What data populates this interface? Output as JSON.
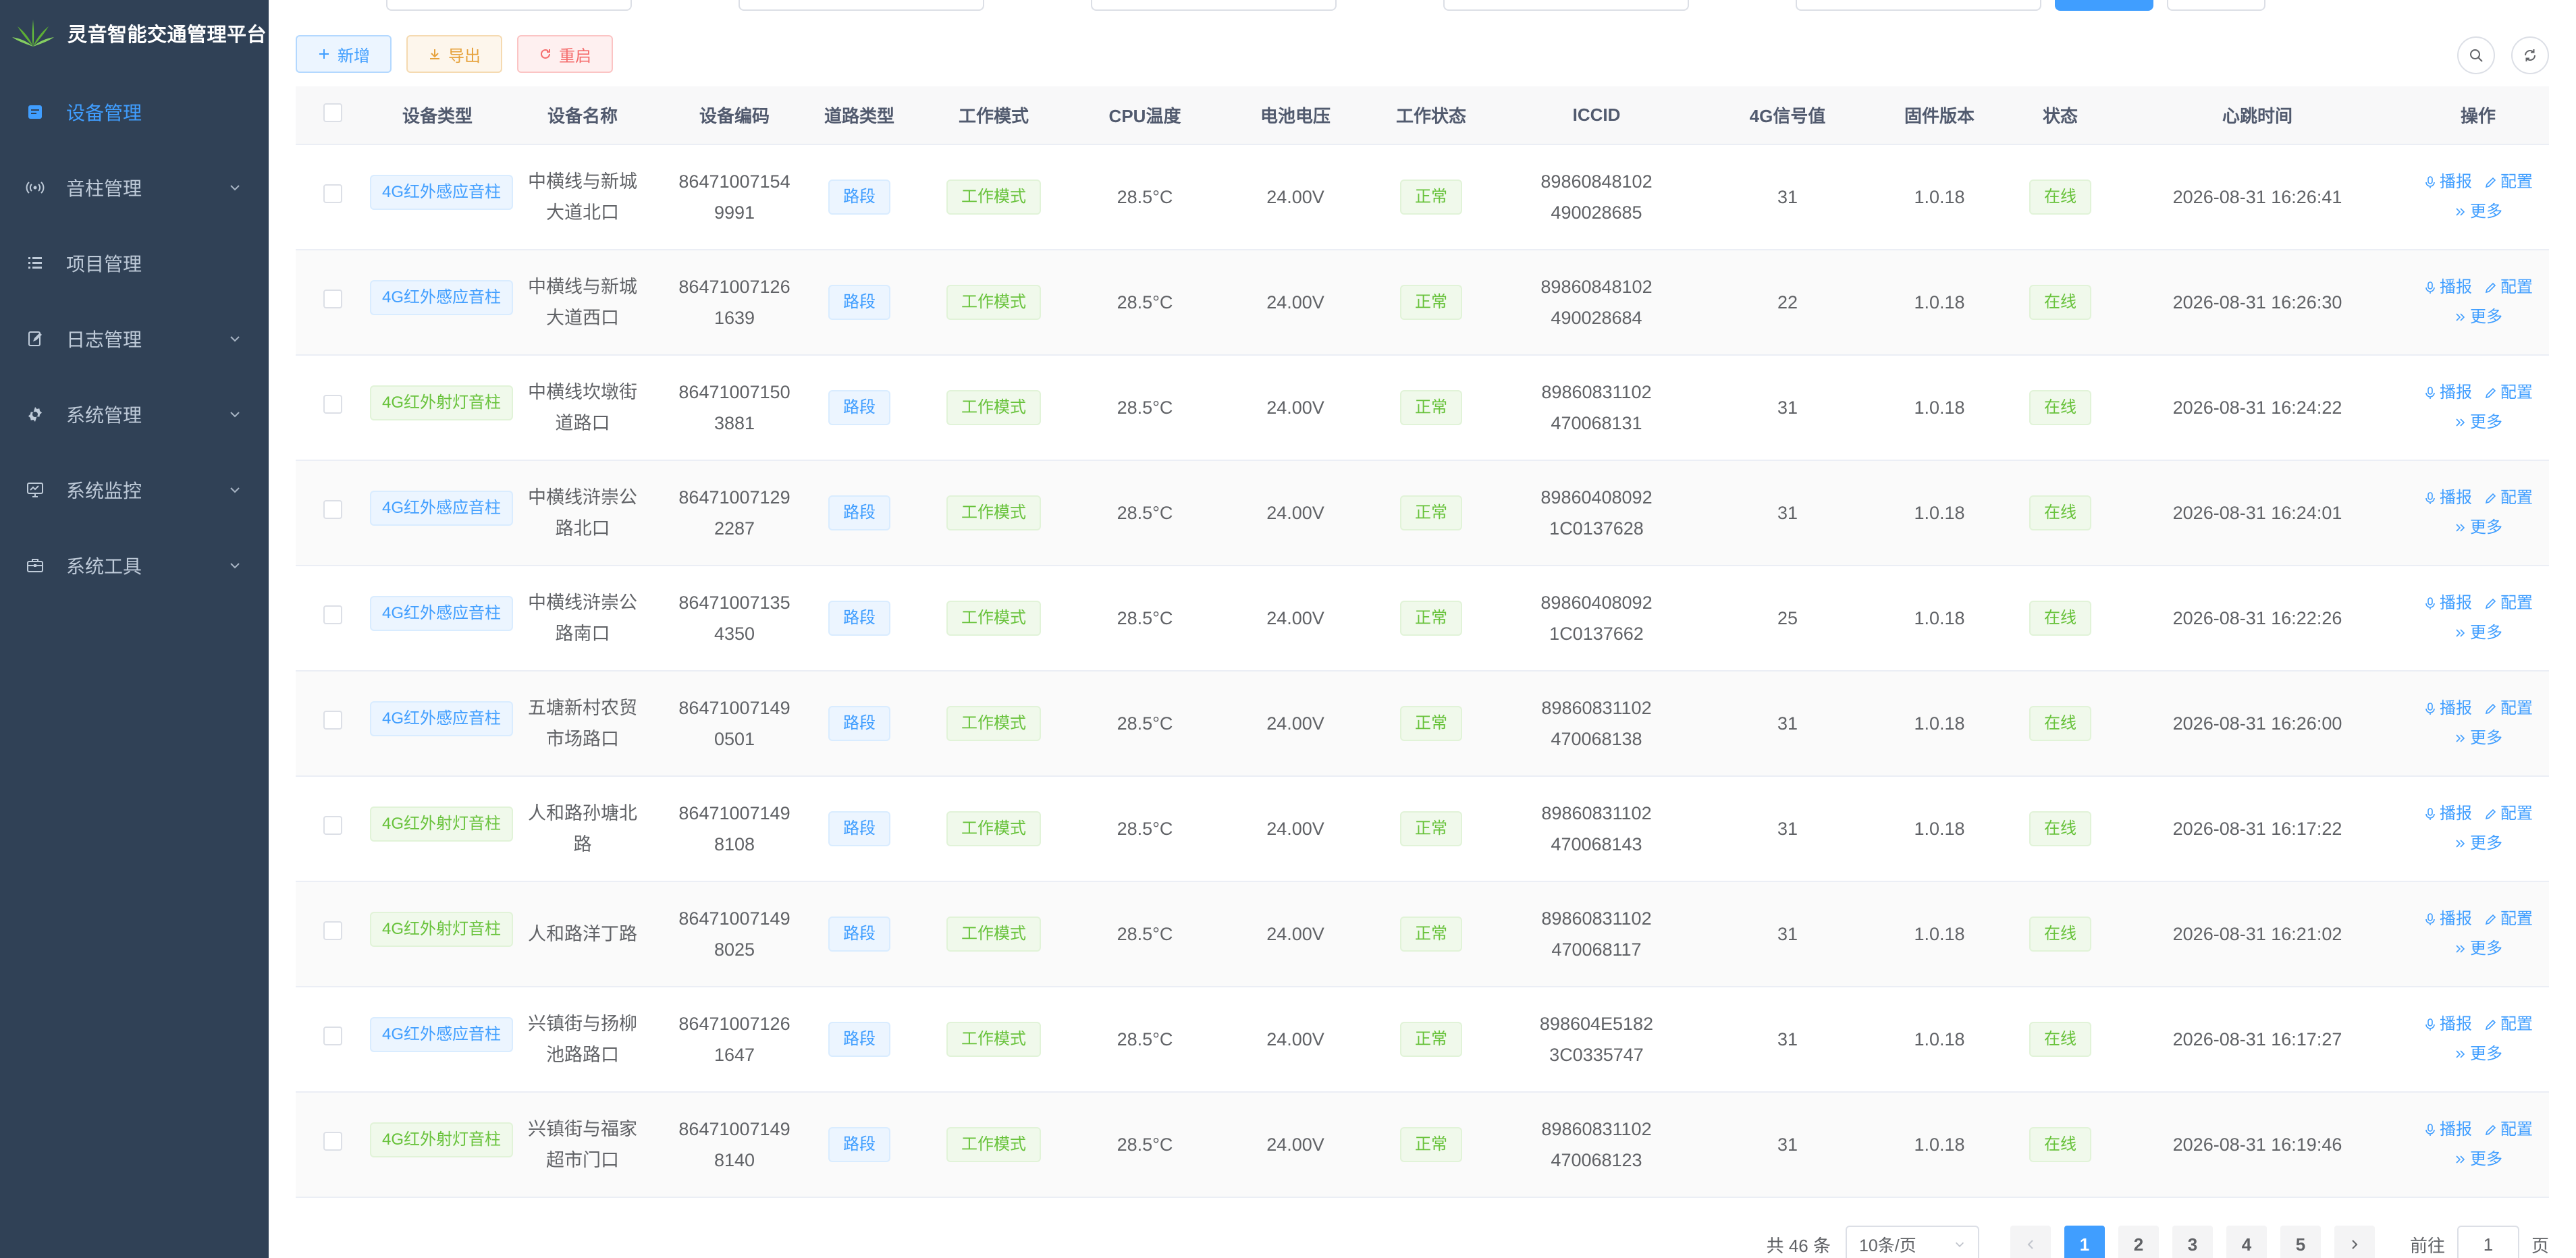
{
  "app": {
    "title": "灵音智能交通管理平台"
  },
  "colors": {
    "sidebar_bg": "#304156",
    "accent": "#409eff",
    "success": "#67c23a",
    "warning": "#e6a23c",
    "danger": "#f56c6c"
  },
  "sidebar": {
    "items": [
      {
        "label": "设备管理",
        "icon": "device-icon",
        "active": true,
        "has_arrow": false
      },
      {
        "label": "音柱管理",
        "icon": "speaker-icon",
        "active": false,
        "has_arrow": true
      },
      {
        "label": "项目管理",
        "icon": "list-icon",
        "active": false,
        "has_arrow": false
      },
      {
        "label": "日志管理",
        "icon": "edit-log-icon",
        "active": false,
        "has_arrow": true
      },
      {
        "label": "系统管理",
        "icon": "gear-icon",
        "active": false,
        "has_arrow": true
      },
      {
        "label": "系统监控",
        "icon": "monitor-icon",
        "active": false,
        "has_arrow": true
      },
      {
        "label": "系统工具",
        "icon": "toolbox-icon",
        "active": false,
        "has_arrow": true
      }
    ]
  },
  "toolbar": {
    "add_label": "新增",
    "export_label": "导出",
    "reboot_label": "重启"
  },
  "table": {
    "headers": {
      "device_type": "设备类型",
      "device_name": "设备名称",
      "device_code": "设备编码",
      "road_type": "道路类型",
      "work_mode": "工作模式",
      "cpu_temp": "CPU温度",
      "battery_voltage": "电池电压",
      "work_status": "工作状态",
      "iccid": "ICCID",
      "signal": "4G信号值",
      "firmware": "固件版本",
      "status": "状态",
      "heartbeat": "心跳时间",
      "actions": "操作"
    },
    "row_actions": {
      "broadcast": "播报",
      "config": "配置",
      "more": "更多"
    },
    "rows": [
      {
        "device_type": "4G红外感应音柱",
        "device_type_color": "blue",
        "name1": "中横线与新城",
        "name2": "大道北口",
        "code1": "86471007154",
        "code2": "9991",
        "road_type": "路段",
        "work_mode": "工作模式",
        "cpu_temp": "28.5°C",
        "voltage": "24.00V",
        "work_status": "正常",
        "iccid1": "89860848102",
        "iccid2": "490028685",
        "signal": "31",
        "firmware": "1.0.18",
        "status": "在线",
        "heartbeat": "2026-08-31 16:26:41"
      },
      {
        "device_type": "4G红外感应音柱",
        "device_type_color": "blue",
        "name1": "中横线与新城",
        "name2": "大道西口",
        "code1": "86471007126",
        "code2": "1639",
        "road_type": "路段",
        "work_mode": "工作模式",
        "cpu_temp": "28.5°C",
        "voltage": "24.00V",
        "work_status": "正常",
        "iccid1": "89860848102",
        "iccid2": "490028684",
        "signal": "22",
        "firmware": "1.0.18",
        "status": "在线",
        "heartbeat": "2026-08-31 16:26:30"
      },
      {
        "device_type": "4G红外射灯音柱",
        "device_type_color": "green",
        "name1": "中横线坎墩街",
        "name2": "道路口",
        "code1": "86471007150",
        "code2": "3881",
        "road_type": "路段",
        "work_mode": "工作模式",
        "cpu_temp": "28.5°C",
        "voltage": "24.00V",
        "work_status": "正常",
        "iccid1": "89860831102",
        "iccid2": "470068131",
        "signal": "31",
        "firmware": "1.0.18",
        "status": "在线",
        "heartbeat": "2026-08-31 16:24:22"
      },
      {
        "device_type": "4G红外感应音柱",
        "device_type_color": "blue",
        "name1": "中横线浒崇公",
        "name2": "路北口",
        "code1": "86471007129",
        "code2": "2287",
        "road_type": "路段",
        "work_mode": "工作模式",
        "cpu_temp": "28.5°C",
        "voltage": "24.00V",
        "work_status": "正常",
        "iccid1": "89860408092",
        "iccid2": "1C0137628",
        "signal": "31",
        "firmware": "1.0.18",
        "status": "在线",
        "heartbeat": "2026-08-31 16:24:01"
      },
      {
        "device_type": "4G红外感应音柱",
        "device_type_color": "blue",
        "name1": "中横线浒崇公",
        "name2": "路南口",
        "code1": "86471007135",
        "code2": "4350",
        "road_type": "路段",
        "work_mode": "工作模式",
        "cpu_temp": "28.5°C",
        "voltage": "24.00V",
        "work_status": "正常",
        "iccid1": "89860408092",
        "iccid2": "1C0137662",
        "signal": "25",
        "firmware": "1.0.18",
        "status": "在线",
        "heartbeat": "2026-08-31 16:22:26"
      },
      {
        "device_type": "4G红外感应音柱",
        "device_type_color": "blue",
        "name1": "五塘新村农贸",
        "name2": "市场路口",
        "code1": "86471007149",
        "code2": "0501",
        "road_type": "路段",
        "work_mode": "工作模式",
        "cpu_temp": "28.5°C",
        "voltage": "24.00V",
        "work_status": "正常",
        "iccid1": "89860831102",
        "iccid2": "470068138",
        "signal": "31",
        "firmware": "1.0.18",
        "status": "在线",
        "heartbeat": "2026-08-31 16:26:00"
      },
      {
        "device_type": "4G红外射灯音柱",
        "device_type_color": "green",
        "name1": "人和路孙塘北",
        "name2": "路",
        "code1": "86471007149",
        "code2": "8108",
        "road_type": "路段",
        "work_mode": "工作模式",
        "cpu_temp": "28.5°C",
        "voltage": "24.00V",
        "work_status": "正常",
        "iccid1": "89860831102",
        "iccid2": "470068143",
        "signal": "31",
        "firmware": "1.0.18",
        "status": "在线",
        "heartbeat": "2026-08-31 16:17:22"
      },
      {
        "device_type": "4G红外射灯音柱",
        "device_type_color": "green",
        "name1": "人和路洋丁路",
        "name2": "",
        "code1": "86471007149",
        "code2": "8025",
        "road_type": "路段",
        "work_mode": "工作模式",
        "cpu_temp": "28.5°C",
        "voltage": "24.00V",
        "work_status": "正常",
        "iccid1": "89860831102",
        "iccid2": "470068117",
        "signal": "31",
        "firmware": "1.0.18",
        "status": "在线",
        "heartbeat": "2026-08-31 16:21:02"
      },
      {
        "device_type": "4G红外感应音柱",
        "device_type_color": "blue",
        "name1": "兴镇街与扬柳",
        "name2": "池路路口",
        "code1": "86471007126",
        "code2": "1647",
        "road_type": "路段",
        "work_mode": "工作模式",
        "cpu_temp": "28.5°C",
        "voltage": "24.00V",
        "work_status": "正常",
        "iccid1": "898604E5182",
        "iccid2": "3C0335747",
        "signal": "31",
        "firmware": "1.0.18",
        "status": "在线",
        "heartbeat": "2026-08-31 16:17:27"
      },
      {
        "device_type": "4G红外射灯音柱",
        "device_type_color": "green",
        "name1": "兴镇街与福家",
        "name2": "超市门口",
        "code1": "86471007149",
        "code2": "8140",
        "road_type": "路段",
        "work_mode": "工作模式",
        "cpu_temp": "28.5°C",
        "voltage": "24.00V",
        "work_status": "正常",
        "iccid1": "89860831102",
        "iccid2": "470068123",
        "signal": "31",
        "firmware": "1.0.18",
        "status": "在线",
        "heartbeat": "2026-08-31 16:19:46"
      }
    ]
  },
  "pagination": {
    "total_text": "共 46 条",
    "page_size": "10条/页",
    "pages": [
      "1",
      "2",
      "3",
      "4",
      "5"
    ],
    "current_page": "1",
    "jump_prefix": "前往",
    "jump_value": "1",
    "jump_suffix": "页"
  }
}
